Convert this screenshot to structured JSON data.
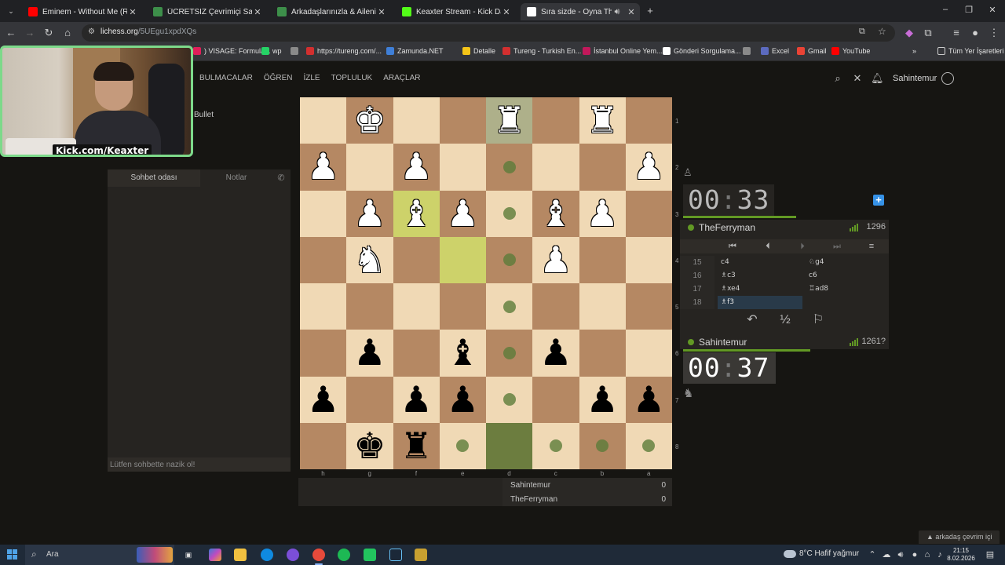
{
  "browser": {
    "tabs": [
      {
        "label": "Eminem - Without Me (Remix) | ",
        "favicon": "youtube-icon",
        "color": "#ff0000"
      },
      {
        "label": "ÜCRETSİZ Çevrimiçi Satranç Oy",
        "favicon": "chess-icon",
        "color": "#3d8f4a"
      },
      {
        "label": "Arkadaşlarınızla & Ailenizle Üc",
        "favicon": "chess-icon",
        "color": "#3d8f4a"
      },
      {
        "label": "Keaxter Stream - Kick Dashboar",
        "favicon": "kick-icon",
        "color": "#53fc18"
      },
      {
        "label": "Sıra sizde - Oyna TheFerrym",
        "favicon": "lichess-icon",
        "color": "#ffffff"
      }
    ],
    "url_host": "lichess.org",
    "url_path": "/5UEgu1xpdXQs",
    "bookmarks": [
      {
        "label": ") VISAGE: Formula...",
        "color": "#e01e5a"
      },
      {
        "label": "wp",
        "color": "#25d366"
      },
      {
        "label": "",
        "color": "#8a8a8a"
      },
      {
        "label": "https://tureng.com/...",
        "color": "#d32f2f"
      },
      {
        "label": "Zamunda.NET",
        "color": "#3f7fd8"
      },
      {
        "label": "Detalle",
        "color": "#f5c518"
      },
      {
        "label": "Tureng - Turkish En...",
        "color": "#d32f2f"
      },
      {
        "label": "İstanbul Online Yem...",
        "color": "#c2185b"
      },
      {
        "label": "Gönderi Sorgulama...",
        "color": "#ffffff"
      },
      {
        "label": "",
        "color": "#8a8a8a"
      },
      {
        "label": "Excel",
        "color": "#5c6bc0"
      },
      {
        "label": "Gmail",
        "color": "#ea4335"
      },
      {
        "label": "YouTube",
        "color": "#ff0000"
      }
    ],
    "all_bookmarks": "Tüm Yer İşaretleri"
  },
  "stream": {
    "overlay_text": "Kick.com/Keaxter"
  },
  "site": {
    "nav": [
      "BULMACALAR",
      "ÖĞREN",
      "İZLE",
      "TOPLULUK",
      "ARAÇLAR"
    ],
    "username": "Sahintemur",
    "game_mode": "Bullet"
  },
  "chat": {
    "tab_room": "Sohbet odası",
    "tab_notes": "Notlar",
    "placeholder": "Lütfen sohbette nazik ol!"
  },
  "board": {
    "orientation": "black",
    "ranks": [
      "1",
      "2",
      "3",
      "4",
      "5",
      "6",
      "7",
      "8"
    ],
    "files": [
      "h",
      "g",
      "f",
      "e",
      "d",
      "c",
      "b",
      "a"
    ],
    "pieces": [
      {
        "sq": "g1",
        "piece": "K",
        "color": "white"
      },
      {
        "sq": "d1",
        "piece": "R",
        "color": "white"
      },
      {
        "sq": "b1",
        "piece": "R",
        "color": "white"
      },
      {
        "sq": "h2",
        "piece": "P",
        "color": "white"
      },
      {
        "sq": "f2",
        "piece": "P",
        "color": "white"
      },
      {
        "sq": "a2",
        "piece": "P",
        "color": "white"
      },
      {
        "sq": "g3",
        "piece": "P",
        "color": "white"
      },
      {
        "sq": "f3",
        "piece": "B",
        "color": "white"
      },
      {
        "sq": "e3",
        "piece": "P",
        "color": "white"
      },
      {
        "sq": "c3",
        "piece": "B",
        "color": "white"
      },
      {
        "sq": "b3",
        "piece": "P",
        "color": "white"
      },
      {
        "sq": "g4",
        "piece": "N",
        "color": "white"
      },
      {
        "sq": "c4",
        "piece": "P",
        "color": "white"
      },
      {
        "sq": "g6",
        "piece": "P",
        "color": "black"
      },
      {
        "sq": "e6",
        "piece": "B",
        "color": "black"
      },
      {
        "sq": "c6",
        "piece": "P",
        "color": "black"
      },
      {
        "sq": "h7",
        "piece": "P",
        "color": "black"
      },
      {
        "sq": "f7",
        "piece": "P",
        "color": "black"
      },
      {
        "sq": "e7",
        "piece": "P",
        "color": "black"
      },
      {
        "sq": "b7",
        "piece": "P",
        "color": "black"
      },
      {
        "sq": "a7",
        "piece": "P",
        "color": "black"
      },
      {
        "sq": "g8",
        "piece": "K",
        "color": "black"
      },
      {
        "sq": "f8",
        "piece": "R",
        "color": "black"
      }
    ],
    "last_move": [
      "e4",
      "f3"
    ],
    "selected": "d8",
    "hover": "d1",
    "move_dots": [
      "d2",
      "d3",
      "d4",
      "d5",
      "d6",
      "d7",
      "e8",
      "c8",
      "b8",
      "a8"
    ]
  },
  "scores": [
    {
      "name": "Sahintemur",
      "score": "0"
    },
    {
      "name": "TheFerryman",
      "score": "0"
    }
  ],
  "clocks": {
    "top": {
      "mm": "00",
      "ss": "33",
      "fraction_left": 0.88
    },
    "bottom": {
      "mm": "00",
      "ss": "37",
      "fraction_left": 0.95
    }
  },
  "players": {
    "top": {
      "name": "TheFerryman",
      "rating": "1296"
    },
    "bottom": {
      "name": "Sahintemur",
      "rating": "1261?"
    }
  },
  "moves": [
    {
      "n": "15",
      "w": "c4",
      "b": "♘g4"
    },
    {
      "n": "16",
      "w": "♗c3",
      "b": "c6"
    },
    {
      "n": "17",
      "w": "♗xe4",
      "b": "♖ad8"
    },
    {
      "n": "18",
      "w": "♗f3",
      "b": ""
    }
  ],
  "current_move_index": 3,
  "actions": {
    "draw_label": "½"
  },
  "taskbar": {
    "search_label": "Ara",
    "weather": "8°C  Hafif yağmur",
    "time": "21:15",
    "date": "8.02.2026"
  },
  "friends_online": "arkadaş çevrim içi",
  "colors": {
    "board_light": "#f0d9b5",
    "board_dark": "#b58863",
    "last_move": "#cdd26a",
    "accent_green": "#629924",
    "selected_move_bg": "#293a49"
  }
}
